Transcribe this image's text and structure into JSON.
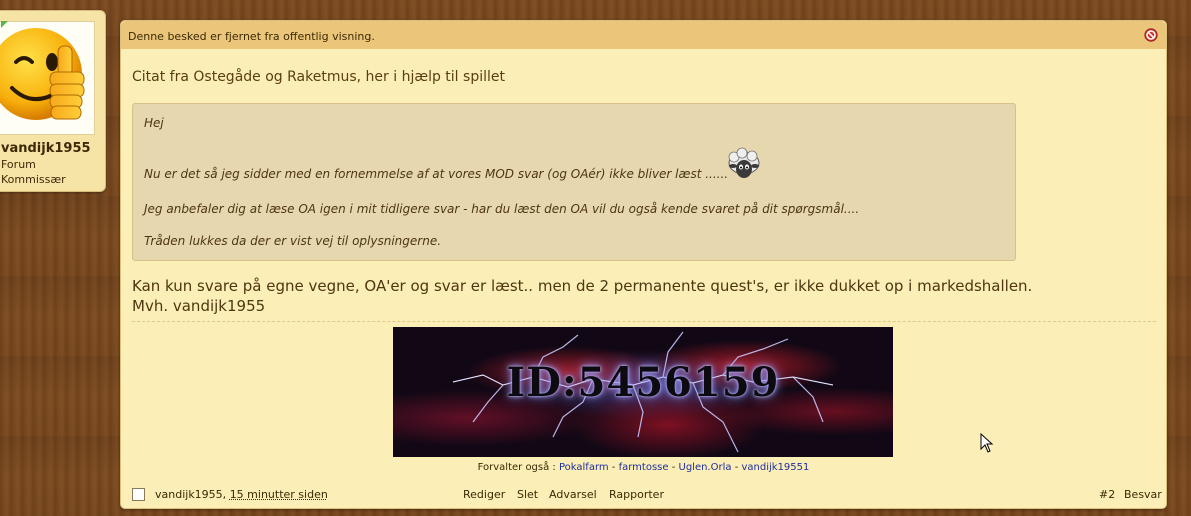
{
  "user": {
    "name": "vandijk1955",
    "title_line1": "Forum",
    "title_line2": "Kommissær"
  },
  "notice": {
    "text": "Denne besked er fjernet fra offentlig visning.",
    "icon": "no-entry-icon"
  },
  "quote": {
    "header": "Citat fra Ostegåde og Raketmus, her i hjælp til spillet",
    "lines": [
      "Hej",
      "Nu er det så jeg sidder med en fornemmelse af at vores MOD svar (og OAér) ikke bliver læst ......",
      "Jeg anbefaler dig at læse OA igen i mit tidligere svar - har du læst den OA vil du også kende svaret på dit spørgsmål....",
      "Tråden lukkes da der er vist vej til oplysningerne."
    ],
    "emoticon": "sheep-icon"
  },
  "body": {
    "line1": "Kan kun svare på egne vegne, OA'er og svar er læst.. men de 2 permanente quest's, er ikke dukket op i markedshallen.",
    "line2": "Mvh. vandijk1955"
  },
  "signature": {
    "banner_text": "ID:5456159",
    "links_prefix": "Forvalter også :",
    "links": [
      "Pokalfarm",
      "farmtosse",
      "Uglen.Orla",
      "vandijk19551"
    ],
    "separator": " - "
  },
  "footer": {
    "author": "vandijk1955,",
    "time": "15 minutter siden",
    "actions": [
      "Rediger",
      "Slet",
      "Advarsel",
      "Rapporter"
    ],
    "post_number": "#2",
    "reply": "Besvar"
  },
  "colors": {
    "panel": "#fbeeb6",
    "notice_bar": "#ebc67a",
    "quote_bg": "#e6d7ae",
    "link": "#2030a0",
    "wood": "#7a4a20"
  }
}
